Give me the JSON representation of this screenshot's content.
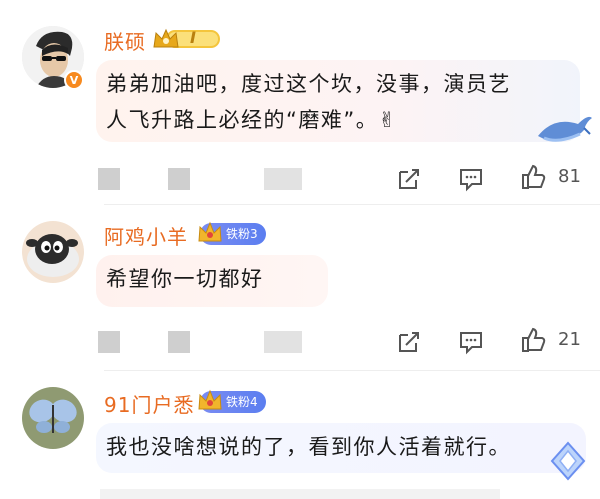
{
  "comments": [
    {
      "username": "朕硕",
      "level_badge": "I",
      "text_line1": "弟弟加油吧，度过这个坎，没事，演员艺",
      "text_line2": "人飞升路上必经的“磨难”。✌",
      "likes": "81"
    },
    {
      "username": "阿鸡小羊",
      "fan_badge": "铁粉3",
      "text_line1": "希望你一切都好",
      "likes": "21"
    },
    {
      "username": "91门户悉",
      "fan_badge": "铁粉4",
      "text_line1": "我也没啥想说的了，看到你人活着就行。"
    }
  ],
  "icons": [
    "share-icon",
    "comment-icon",
    "like-icon",
    "verified-icon",
    "crown-icon",
    "whale-icon",
    "diamond-icon"
  ],
  "colors": {
    "username": "#e86b22",
    "fan_badge": "#6a84f1",
    "verified": "#f78a1f"
  }
}
